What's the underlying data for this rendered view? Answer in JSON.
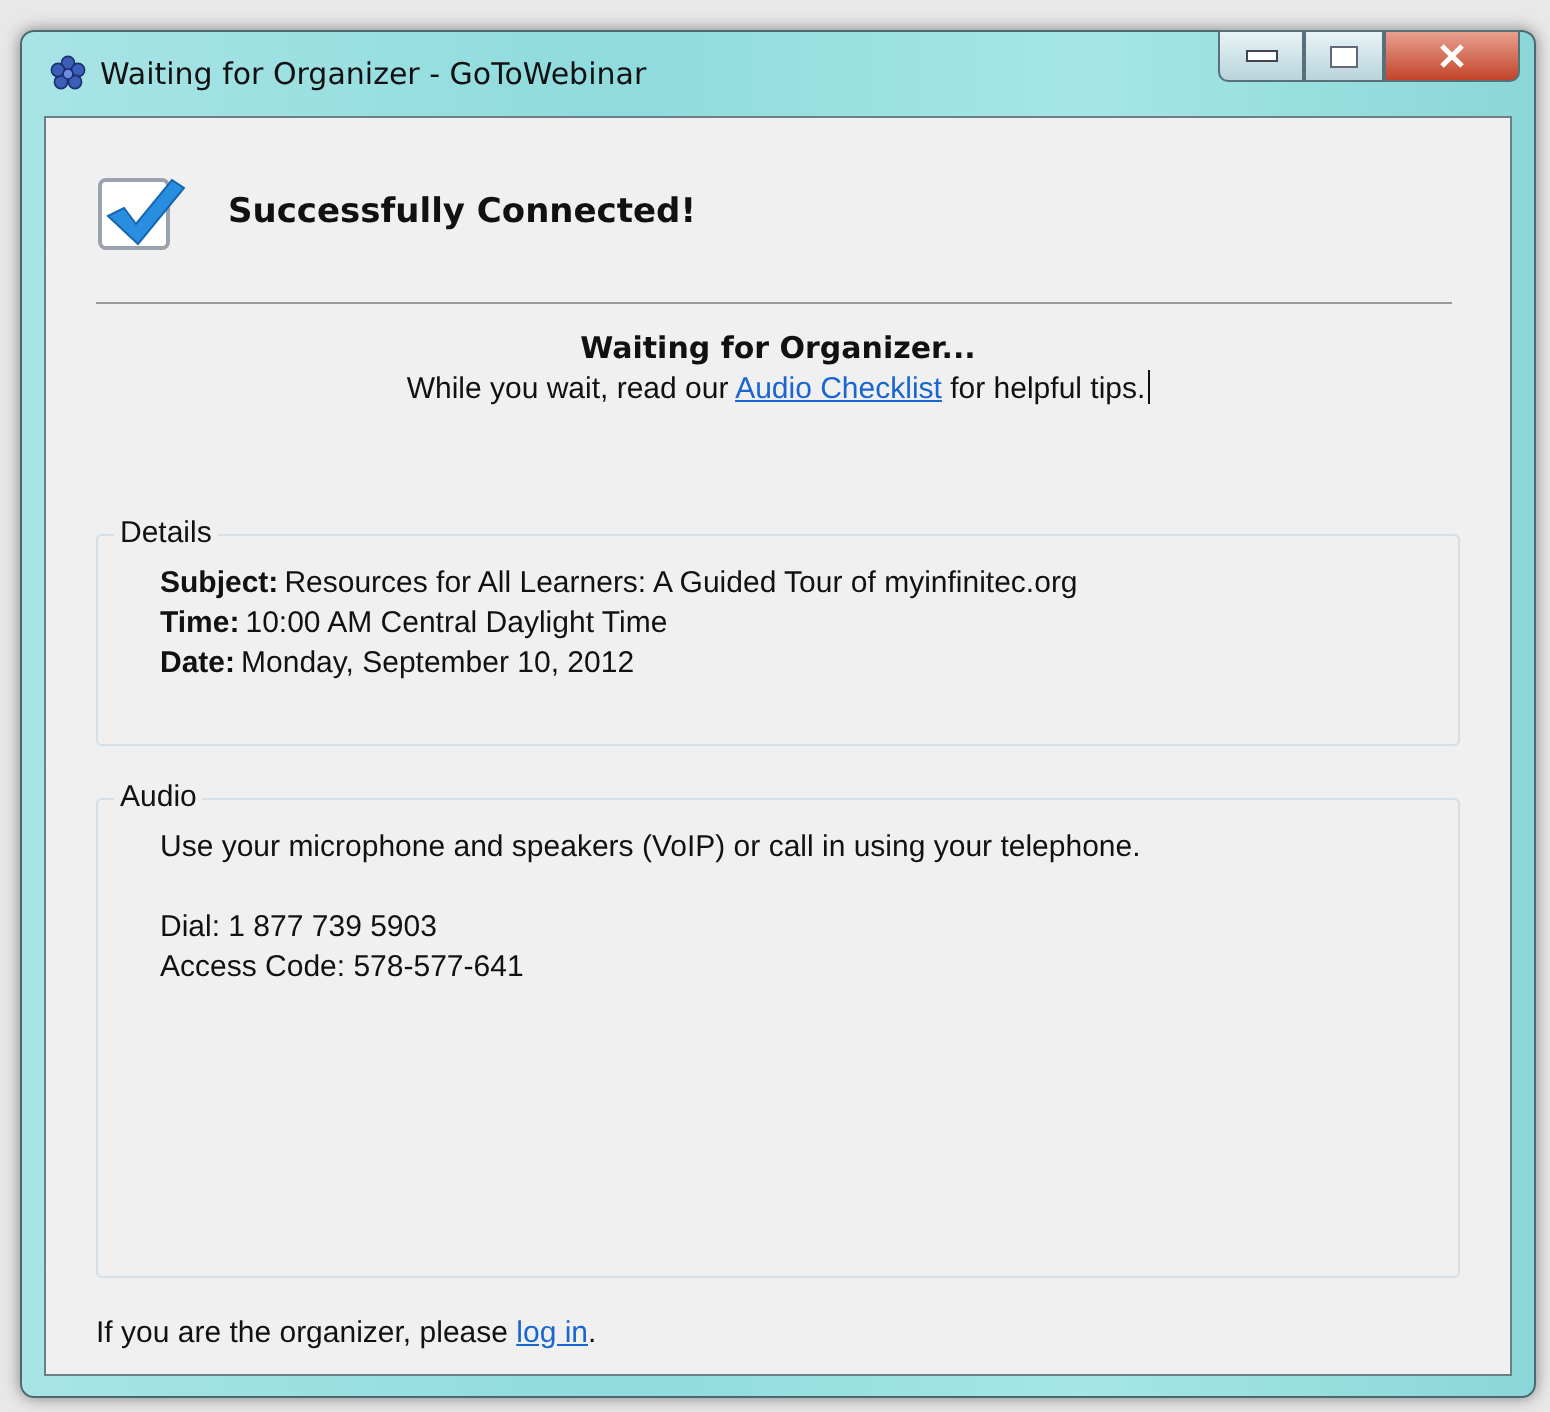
{
  "window": {
    "title": "Waiting for Organizer - GoToWebinar"
  },
  "status": {
    "heading": "Successfully Connected!",
    "checked": true
  },
  "waiting": {
    "heading": "Waiting for Organizer...",
    "text_before": "While you wait, read our ",
    "link": "Audio Checklist",
    "text_after": " for helpful tips."
  },
  "details": {
    "title": "Details",
    "fields": [
      {
        "label": "Subject:",
        "value": "Resources for All Learners:  A Guided Tour of myinfinitec.org"
      },
      {
        "label": "Time:",
        "value": "10:00 AM Central Daylight Time"
      },
      {
        "label": "Date:",
        "value": "Monday, September 10, 2012"
      }
    ]
  },
  "audio": {
    "title": "Audio",
    "intro": "Use your microphone and speakers (VoIP) or call in using your telephone.",
    "lines": [
      "Dial: 1 877 739 5903",
      "Access Code: 578-577-641"
    ]
  },
  "footer": {
    "text": "If you are the organizer, please ",
    "link": "log in",
    "after": "."
  }
}
